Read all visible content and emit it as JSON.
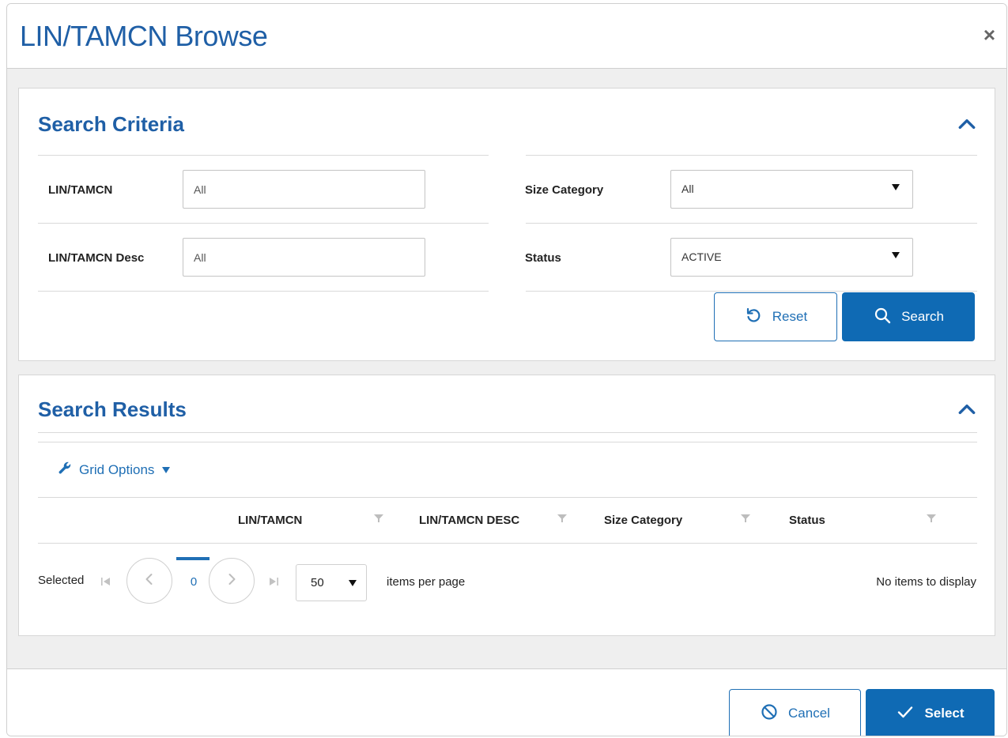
{
  "dialog": {
    "title": "LIN/TAMCN Browse",
    "close_glyph": "×"
  },
  "criteria": {
    "title": "Search Criteria",
    "collapse_icon": "chevron-up-icon",
    "fields": {
      "lin_tamcn": {
        "label": "LIN/TAMCN",
        "value": "",
        "placeholder": "All"
      },
      "lin_tamcn_desc": {
        "label": "LIN/TAMCN Desc",
        "value": "",
        "placeholder": "All"
      },
      "size_category": {
        "label": "Size Category",
        "value": "All"
      },
      "status": {
        "label": "Status",
        "value": "ACTIVE"
      }
    },
    "reset_label": "Reset",
    "search_label": "Search"
  },
  "results": {
    "title": "Search Results",
    "collapse_icon": "chevron-up-icon",
    "grid_options_label": "Grid Options",
    "columns": [
      "LIN/TAMCN",
      "LIN/TAMCN DESC",
      "Size Category",
      "Status"
    ],
    "rows": [],
    "pager": {
      "selected_label": "Selected",
      "current_page": "0",
      "page_size": "50",
      "items_per_page_label": "items per page",
      "empty_label": "No items to display"
    }
  },
  "footer": {
    "cancel_label": "Cancel",
    "select_label": "Select"
  },
  "colors": {
    "brand_blue": "#1f5fa6",
    "primary_button": "#0f6ab4",
    "body_background": "#efefef"
  }
}
